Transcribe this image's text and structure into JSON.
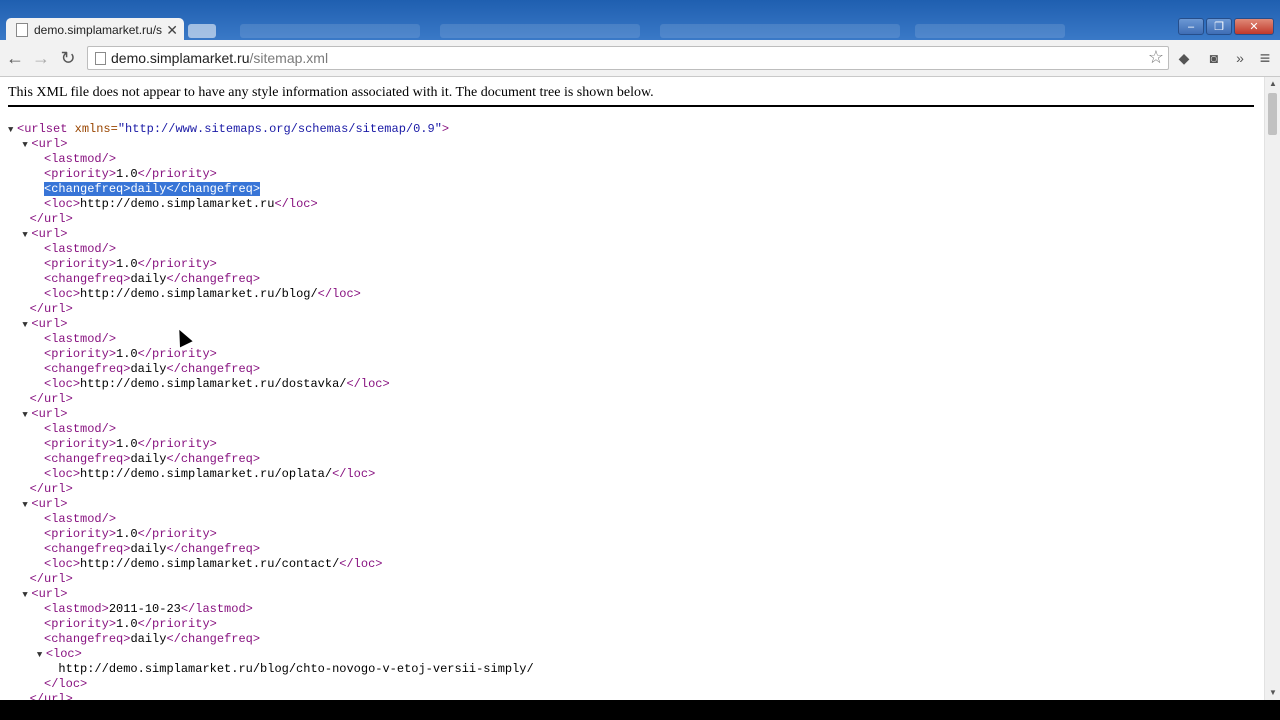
{
  "tab": {
    "title": "demo.simplamarket.ru/sitemap.xml",
    "close": "✕"
  },
  "window": {
    "minimize": "–",
    "maximize": "❐",
    "close": "✕"
  },
  "toolbar": {
    "back": "←",
    "forward": "→",
    "reload": "↻",
    "url_host": "demo.simplamarket.ru",
    "url_path": "/sitemap.xml",
    "star": "☆",
    "overflow": "»",
    "menu": "≡"
  },
  "notice": "This XML file does not appear to have any style information associated with it. The document tree is shown below.",
  "xml": {
    "root_name": "urlset",
    "root_attr_name": "xmlns",
    "root_attr_value": "\"http://www.sitemaps.org/schemas/sitemap/0.9\"",
    "urls": [
      {
        "lastmod": "",
        "priority": "1.0",
        "changefreq": "daily",
        "loc": "http://demo.simplamarket.ru"
      },
      {
        "lastmod": "",
        "priority": "1.0",
        "changefreq": "daily",
        "loc": "http://demo.simplamarket.ru/blog/"
      },
      {
        "lastmod": "",
        "priority": "1.0",
        "changefreq": "daily",
        "loc": "http://demo.simplamarket.ru/dostavka/"
      },
      {
        "lastmod": "",
        "priority": "1.0",
        "changefreq": "daily",
        "loc": "http://demo.simplamarket.ru/oplata/"
      },
      {
        "lastmod": "",
        "priority": "1.0",
        "changefreq": "daily",
        "loc": "http://demo.simplamarket.ru/contact/"
      },
      {
        "lastmod": "2011-10-23",
        "priority": "1.0",
        "changefreq": "daily",
        "loc": "http://demo.simplamarket.ru/blog/chto-novogo-v-etoj-versii-simply/",
        "loc_expanded": true
      }
    ]
  },
  "colors": {
    "tag": "#881280",
    "selection": "#3875d7",
    "chrome": "#f2f2f2"
  }
}
